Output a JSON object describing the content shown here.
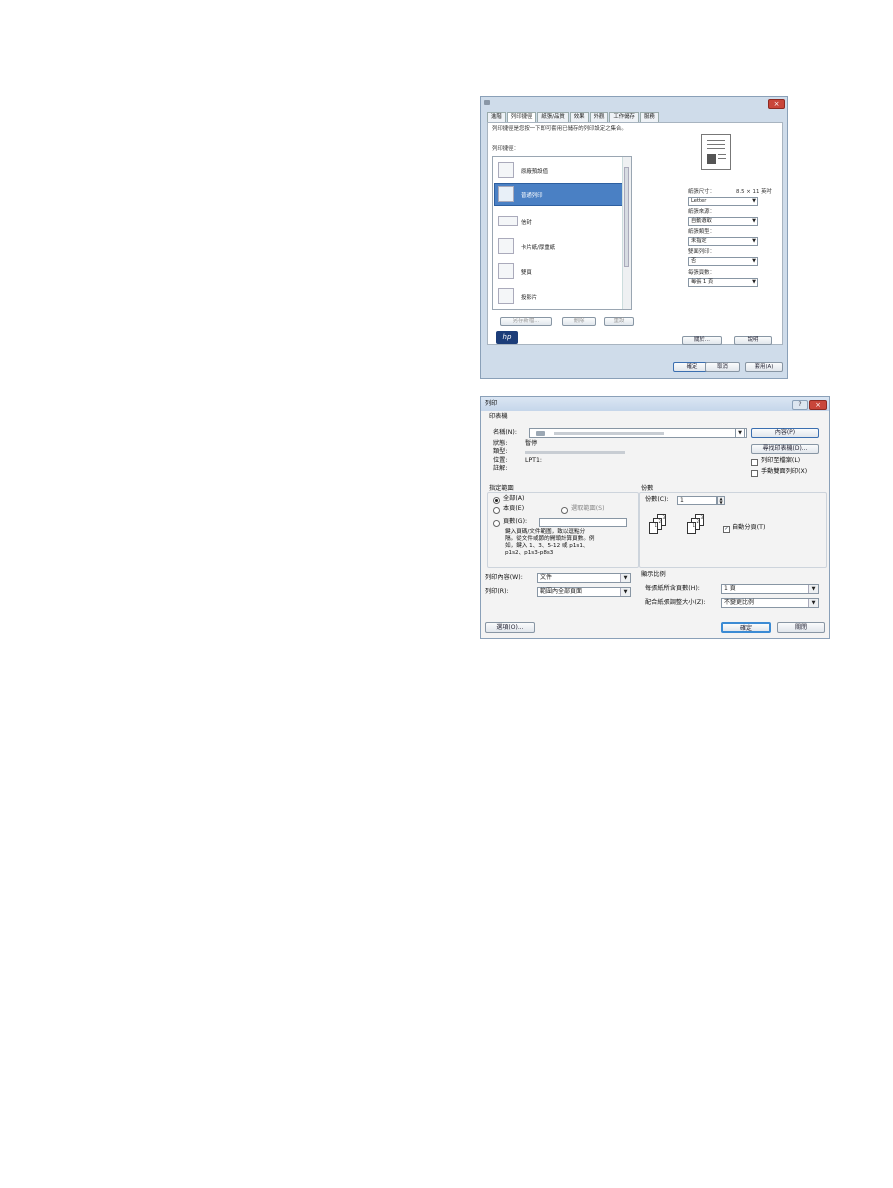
{
  "advanced_dialog": {
    "tabs": [
      "進階",
      "列印捷徑",
      "紙張/品質",
      "效果",
      "外觀",
      "工作儲存",
      "服務"
    ],
    "active_tab": "列印捷徑",
    "description": "列印捷徑是您按一下即可套用已儲存的列印設定之集合。",
    "shortcuts_label": "列印捷徑：",
    "shortcuts": [
      "原廠預設值",
      "普通列印",
      "信封",
      "卡片紙/厚重紙",
      "雙頁",
      "投影片"
    ],
    "selected_shortcut": "普通列印",
    "save_as_button": "另存新檔...",
    "delete_button": "刪除",
    "reset_button": "重設",
    "paper_size_label": "紙張尺寸：",
    "paper_size_value": "8.5 × 11 英吋",
    "paper_size_select": "Letter",
    "paper_source_label": "紙張來源：",
    "paper_source_select": "自動選取",
    "paper_type_label": "紙張類型：",
    "paper_type_select": "未指定",
    "duplex_label": "雙面列印：",
    "duplex_select": "否",
    "pages_per_sheet_label": "每張頁數：",
    "pages_per_sheet_select": "每張 1 頁",
    "about_button": "關於...",
    "help_button": "說明",
    "ok_button": "確定",
    "cancel_button": "取消",
    "apply_button": "套用(A)"
  },
  "print_dialog": {
    "title": "列印",
    "printer_group": "印表機",
    "name_label": "名稱(N):",
    "status_label": "狀態:",
    "status_value": "暫停",
    "type_label": "類型:",
    "where_label": "位置:",
    "where_value": "LPT1:",
    "comment_label": "註解:",
    "properties_button": "內容(P)",
    "find_printer_button": "尋找印表機(D)...",
    "print_to_file_label": "列印至檔案(L)",
    "manual_duplex_label": "手動雙面列印(X)",
    "range_group": "指定範圍",
    "all_label": "全部(A)",
    "current_page_label": "本頁(E)",
    "selection_label": "選取範圍(S)",
    "pages_label": "頁數(G):",
    "help_text_1": "鍵入頁碼/文件範圍，致以逗點分",
    "help_text_2": "隔。從文件或節的開頭計算頁數。例",
    "help_text_3": "如，鍵入 1、3、5-12 或 p1s1、",
    "help_text_4": "p1s2、p1s3-p8s3",
    "copies_group": "份數",
    "copies_label": "份數(C):",
    "copies_value": "1",
    "collate_label": "自動分頁(T)",
    "print_what_label": "列印內容(W):",
    "print_what_value": "文件",
    "print_label": "列印(R):",
    "print_value": "範圍內全部頁面",
    "zoom_group": "顯示比例",
    "pages_per_sheet_label": "每張紙所含頁數(H):",
    "pages_per_sheet_value": "1 頁",
    "scale_label": "配合紙張調整大小(Z):",
    "scale_value": "不變更比例",
    "options_button": "選項(O)...",
    "ok_button": "確定",
    "close_button": "關閉"
  },
  "icons": [
    "close-icon",
    "help-icon",
    "printer-icon",
    "hp-logo",
    "dropdown-arrow-icon",
    "spinner-icon"
  ],
  "colors": {
    "selection": "#4a80c4",
    "close_button": "#c9463a",
    "titlebar": "#c5d6ea"
  }
}
